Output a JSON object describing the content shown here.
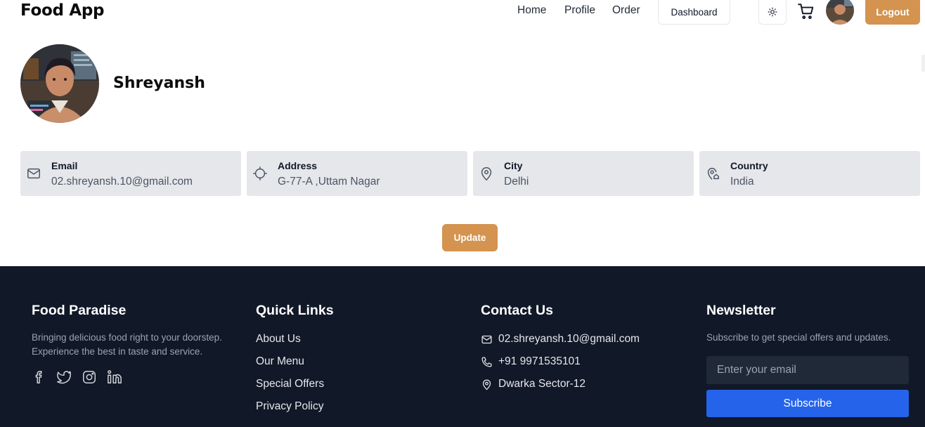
{
  "header": {
    "brand": "Food App",
    "nav": [
      "Home",
      "Profile",
      "Order"
    ],
    "dashboard_label": "Dashboard",
    "theme_icon": "sun-icon",
    "cart_icon": "cart-icon",
    "logout_label": "Logout"
  },
  "profile": {
    "name": "Shreyansh",
    "fields": [
      {
        "label": "Email",
        "value": "02.shreyansh.10@gmail.com",
        "icon": "mail-icon"
      },
      {
        "label": "Address",
        "value": "G-77-A ,Uttam Nagar",
        "icon": "crosshair-icon"
      },
      {
        "label": "City",
        "value": "Delhi",
        "icon": "map-pin-icon"
      },
      {
        "label": "Country",
        "value": "India",
        "icon": "map-pin-home-icon"
      }
    ],
    "update_label": "Update"
  },
  "footer": {
    "about": {
      "title": "Food Paradise",
      "line1": "Bringing delicious food right to your doorstep.",
      "line2": "Experience the best in taste and service.",
      "social": [
        "facebook-icon",
        "twitter-icon",
        "instagram-icon",
        "linkedin-icon"
      ]
    },
    "quick_links": {
      "title": "Quick Links",
      "items": [
        "About Us",
        "Our Menu",
        "Special Offers",
        "Privacy Policy"
      ]
    },
    "contact": {
      "title": "Contact Us",
      "email": "02.shreyansh.10@gmail.com",
      "phone": "+91 9971535101",
      "address": "Dwarka Sector-12"
    },
    "newsletter": {
      "title": "Newsletter",
      "text": "Subscribe to get special offers and updates.",
      "placeholder": "Enter your email",
      "button": "Subscribe"
    }
  },
  "colors": {
    "accent": "#d4934f",
    "footer_bg": "#111827",
    "subscribe": "#2563eb",
    "card_bg": "#e5e7eb"
  }
}
